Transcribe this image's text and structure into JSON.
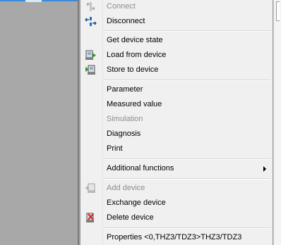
{
  "menu": {
    "items": [
      {
        "label": "Connect",
        "icon": "connect-icon",
        "disabled": true
      },
      {
        "label": "Disconnect",
        "icon": "disconnect-icon",
        "disabled": false
      },
      {
        "label": "Get device state",
        "icon": "",
        "disabled": false
      },
      {
        "label": "Load from device",
        "icon": "load-from-device-icon",
        "disabled": false
      },
      {
        "label": "Store to device",
        "icon": "store-to-device-icon",
        "disabled": false
      },
      {
        "label": "Parameter",
        "icon": "",
        "disabled": false
      },
      {
        "label": "Measured value",
        "icon": "",
        "disabled": false
      },
      {
        "label": "Simulation",
        "icon": "",
        "disabled": true
      },
      {
        "label": "Diagnosis",
        "icon": "",
        "disabled": false
      },
      {
        "label": "Print",
        "icon": "",
        "disabled": false
      },
      {
        "label": "Additional functions",
        "icon": "",
        "disabled": false,
        "submenu": true
      },
      {
        "label": "Add device",
        "icon": "add-device-icon",
        "disabled": true
      },
      {
        "label": "Exchange device",
        "icon": "",
        "disabled": false
      },
      {
        "label": "Delete device",
        "icon": "delete-device-icon",
        "disabled": false
      },
      {
        "label": "Properties <0,THZ3/TDZ3>THZ3/TDZ3",
        "icon": "",
        "disabled": false
      }
    ]
  },
  "colors": {
    "menu_background": "#f0f0f0",
    "disabled_text": "#8d8d8d",
    "left_panel": "#a8a8a8",
    "selection_strip": "#3c8cd9"
  }
}
